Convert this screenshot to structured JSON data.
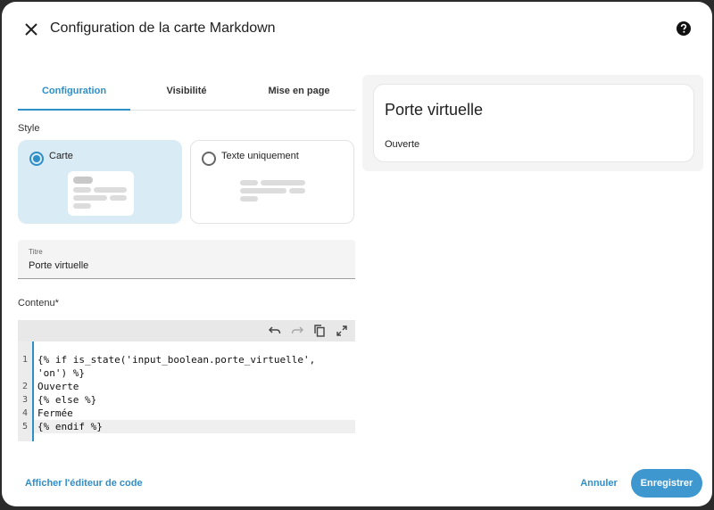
{
  "dialog": {
    "title": "Configuration de la carte Markdown",
    "close_icon": "close-icon",
    "help_icon": "help-icon"
  },
  "tabs": [
    {
      "label": "Configuration",
      "active": true
    },
    {
      "label": "Visibilité",
      "active": false
    },
    {
      "label": "Mise en page",
      "active": false
    }
  ],
  "style": {
    "label": "Style",
    "options": [
      {
        "label": "Carte",
        "selected": true
      },
      {
        "label": "Texte uniquement",
        "selected": false
      }
    ]
  },
  "title_field": {
    "label": "Titre",
    "value": "Porte virtuelle"
  },
  "content": {
    "label": "Contenu*",
    "toolbar_icons": [
      "undo-icon",
      "redo-icon",
      "copy-icon",
      "fullscreen-icon"
    ],
    "line_numbers": [
      "1",
      "2",
      "3",
      "4",
      "5"
    ],
    "lines": [
      "{% if is_state('input_boolean.porte_virtuelle',",
      "'on') %}",
      "Ouverte",
      "{% else %}",
      "Fermée",
      "{% endif %}"
    ]
  },
  "preview": {
    "title": "Porte virtuelle",
    "body": "Ouverte"
  },
  "footer": {
    "code_editor_link": "Afficher l'éditeur de code",
    "cancel": "Annuler",
    "save": "Enregistrer"
  },
  "colors": {
    "accent": "#2f8fc7",
    "selected_card": "#d9ebf5",
    "save_button": "#3f97cf"
  }
}
